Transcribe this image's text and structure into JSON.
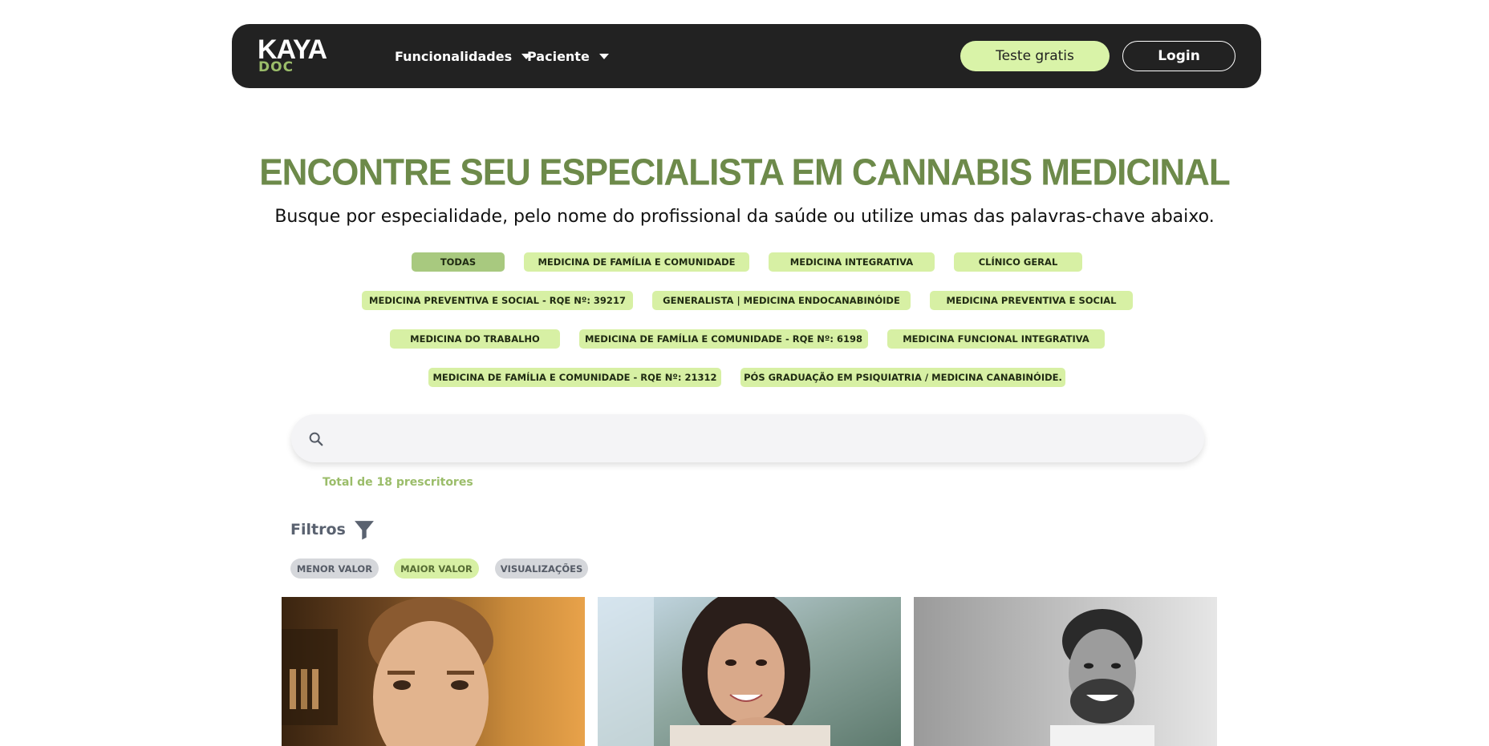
{
  "header": {
    "logo_text": "KAYA",
    "logo_sub": "DOC",
    "nav": [
      {
        "label": "Funcionalidades"
      },
      {
        "label": "Paciente"
      }
    ],
    "trial_label": "Teste gratis",
    "login_label": "Login"
  },
  "hero": {
    "title": "ENCONTRE SEU ESPECIALISTA EM CANNABIS MEDICINAL",
    "subtitle": "Busque por especialidade, pelo nome do profissional da saúde ou utilize umas das palavras-chave abaixo."
  },
  "specialties": [
    {
      "label": "TODAS",
      "active": true
    },
    {
      "label": "MEDICINA DE FAMÍLIA E COMUNIDADE"
    },
    {
      "label": "MEDICINA INTEGRATIVA"
    },
    {
      "label": "CLÍNICO GERAL"
    },
    {
      "label": "MEDICINA PREVENTIVA E SOCIAL - RQE Nº: 39217"
    },
    {
      "label": "GENERALISTA | MEDICINA ENDOCANABINÓIDE"
    },
    {
      "label": "MEDICINA PREVENTIVA E SOCIAL"
    },
    {
      "label": "MEDICINA DO TRABALHO"
    },
    {
      "label": "MEDICINA DE FAMÍLIA E COMUNIDADE - RQE Nº: 6198"
    },
    {
      "label": "MEDICINA FUNCIONAL INTEGRATIVA"
    },
    {
      "label": "MEDICINA DE FAMÍLIA E COMUNIDADE - RQE Nº: 21312"
    },
    {
      "label": "PÓS GRADUAÇÃO EM PSIQUIATRIA / MEDICINA CANABINÓIDE."
    }
  ],
  "search": {
    "value": "",
    "placeholder": ""
  },
  "results": {
    "total_text": "Total de 18 prescritores"
  },
  "filters": {
    "label": "Filtros",
    "sort_options": [
      {
        "label": "MENOR VALOR"
      },
      {
        "label": "MAIOR VALOR",
        "active": true
      },
      {
        "label": "VISUALIZAÇÕES"
      }
    ]
  },
  "colors": {
    "brand_green": "#6d8a4a",
    "chip_green": "#d7f0a4",
    "chip_active": "#a8c97f",
    "navbar_bg": "#222222"
  }
}
